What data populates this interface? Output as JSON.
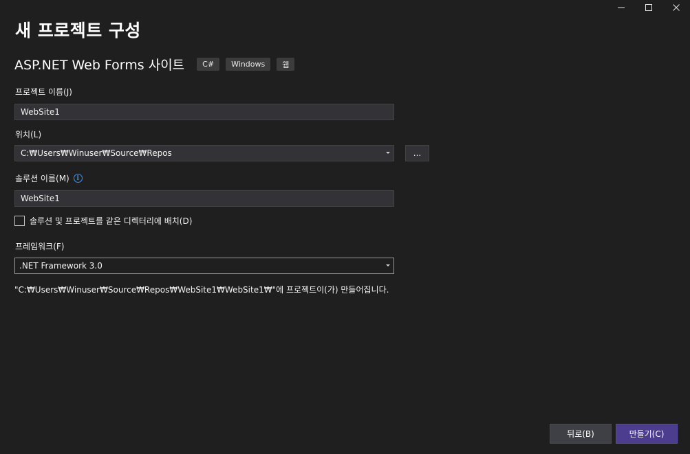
{
  "window_controls": {
    "minimize": "—",
    "maximize": "☐",
    "close": "✕"
  },
  "page_title": "새 프로젝트 구성",
  "template": {
    "name": "ASP.NET Web Forms 사이트",
    "tags": [
      "C#",
      "Windows",
      "웹"
    ]
  },
  "project_name": {
    "label": "프로젝트 이름(J)",
    "value": "WebSite1"
  },
  "location": {
    "label": "위치(L)",
    "value": "C:₩Users₩Winuser₩Source₩Repos",
    "browse_label": "..."
  },
  "solution_name": {
    "label": "솔루션 이름(M)",
    "info_icon": "i",
    "value": "WebSite1"
  },
  "same_directory": {
    "label": "솔루션 및 프로젝트를 같은 디렉터리에 배치(D)",
    "checked": false
  },
  "framework": {
    "label": "프레임워크(F)",
    "value": ".NET Framework 3.0"
  },
  "path_note": "\"C:₩Users₩Winuser₩Source₩Repos₩WebSite1₩WebSite1₩\"에 프로젝트이(가) 만들어집니다.",
  "buttons": {
    "back": "뒤로(B)",
    "create": "만들기(C)"
  },
  "colors": {
    "background": "#1f1f1f",
    "input": "#333337",
    "accent": "#4d3d8f",
    "info": "#3794ff"
  }
}
